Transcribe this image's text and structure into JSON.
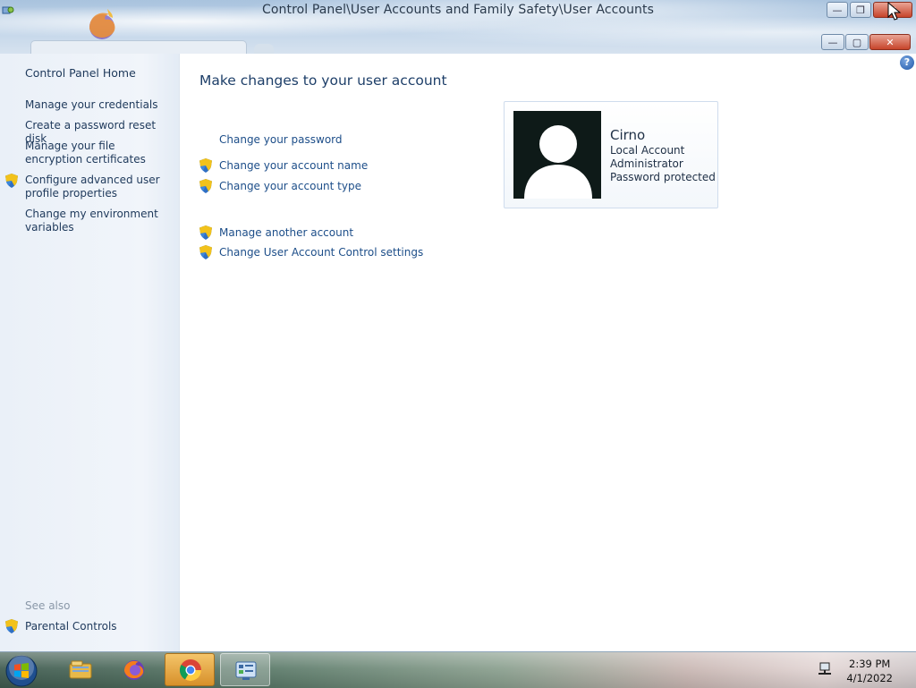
{
  "window": {
    "title": "Control Panel\\User Accounts and Family Safety\\User Accounts"
  },
  "sidebar": {
    "home": "Control Panel Home",
    "items": [
      {
        "label": "Manage your credentials",
        "shield": false
      },
      {
        "label": "Create a password reset disk",
        "shield": false
      },
      {
        "label": "Manage your file encryption certificates",
        "shield": false
      },
      {
        "label": "Configure advanced user profile properties",
        "shield": true
      },
      {
        "label": "Change my environment variables",
        "shield": false
      }
    ],
    "see_also_label": "See also",
    "see_also_items": [
      {
        "label": "Parental Controls",
        "shield": true
      }
    ]
  },
  "main": {
    "title": "Make changes to your user account",
    "tasks": [
      {
        "label": "Change your password",
        "shield": false
      },
      {
        "label": "Change your account name",
        "shield": true
      },
      {
        "label": "Change your account type",
        "shield": true
      }
    ],
    "other_tasks": [
      {
        "label": "Manage another account",
        "shield": true
      },
      {
        "label": "Change User Account Control settings",
        "shield": true
      }
    ]
  },
  "account": {
    "name": "Cirno",
    "lines": [
      "Local Account",
      "Administrator",
      "Password protected"
    ]
  },
  "taskbar": {
    "time": "2:39 PM",
    "date": "4/1/2022",
    "pinned": [
      "explorer-icon",
      "firefox-icon",
      "chrome-icon",
      "control-panel-icon"
    ]
  },
  "colors": {
    "link": "#1d4e89",
    "sidebar_text": "#1e395b",
    "accent": "#1e3f69"
  }
}
